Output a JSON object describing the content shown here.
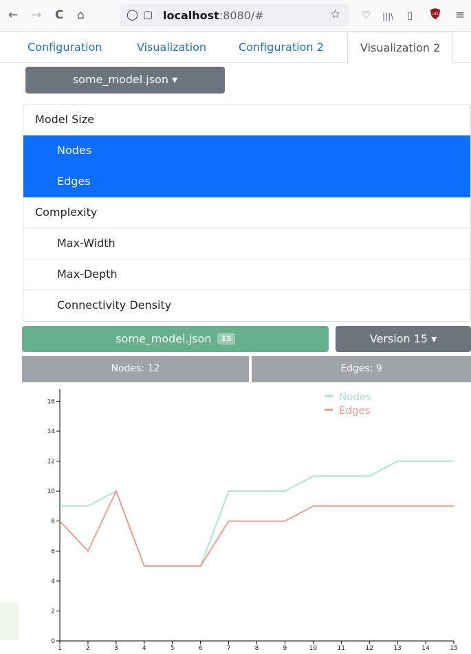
{
  "browser": {
    "back_icon": "←",
    "forward_icon": "→",
    "reload_icon": "C",
    "home_icon": "⌂",
    "url_host": "localhost",
    "url_rest": ":8080/#",
    "star_icon": "☆",
    "pocket_icon": "♡",
    "library_icon": "|||\\",
    "sidebar_icon": "▯",
    "menu_icon": "≡"
  },
  "tabs": [
    {
      "label": "Configuration"
    },
    {
      "label": "Visualization"
    },
    {
      "label": "Configuration 2"
    },
    {
      "label": "Visualization 2"
    }
  ],
  "active_tab": "Visualization 2",
  "model_dropdown": {
    "label": "some_model.json ▾"
  },
  "metrics": {
    "groups": [
      {
        "label": "Model Size"
      },
      {
        "label": "Complexity"
      }
    ],
    "items": [
      {
        "label": "Nodes"
      },
      {
        "label": "Edges"
      },
      {
        "label": "Max-Width"
      },
      {
        "label": "Max-Depth"
      },
      {
        "label": "Connectivity Density"
      }
    ]
  },
  "file_bar": {
    "file_label": "some_model.json",
    "badge": "15",
    "version_label": "Version 15 ▾"
  },
  "stats": {
    "nodes": "Nodes: 12",
    "edges": "Edges: 9"
  },
  "colors": {
    "active": "#0d6efd",
    "nodes_series": "#a7e3d3",
    "edges_series": "#ee9a8d",
    "file_button": "#66b08e",
    "secondary": "#6c757d"
  },
  "chart_data": {
    "type": "line",
    "x": [
      1,
      2,
      3,
      4,
      5,
      6,
      7,
      8,
      9,
      10,
      11,
      12,
      13,
      14,
      15
    ],
    "series": [
      {
        "name": "Nodes",
        "values": [
          9,
          9,
          10,
          5,
          5,
          5,
          10,
          10,
          10,
          11,
          11,
          11,
          12,
          12,
          12
        ]
      },
      {
        "name": "Edges",
        "values": [
          8,
          6,
          10,
          5,
          5,
          5,
          8,
          8,
          8,
          9,
          9,
          9,
          9,
          9,
          9
        ]
      }
    ],
    "xticks": [
      "1",
      "2",
      "3",
      "4",
      "5",
      "6",
      "7",
      "8",
      "9",
      "10",
      "11",
      "12",
      "13",
      "14",
      "15"
    ],
    "yticks": [
      "0",
      "2",
      "4",
      "6",
      "8",
      "10",
      "12",
      "14",
      "16"
    ],
    "ylim": [
      0,
      16.8
    ],
    "xlim": [
      1,
      15
    ],
    "legend": "top-right",
    "grid": false
  }
}
